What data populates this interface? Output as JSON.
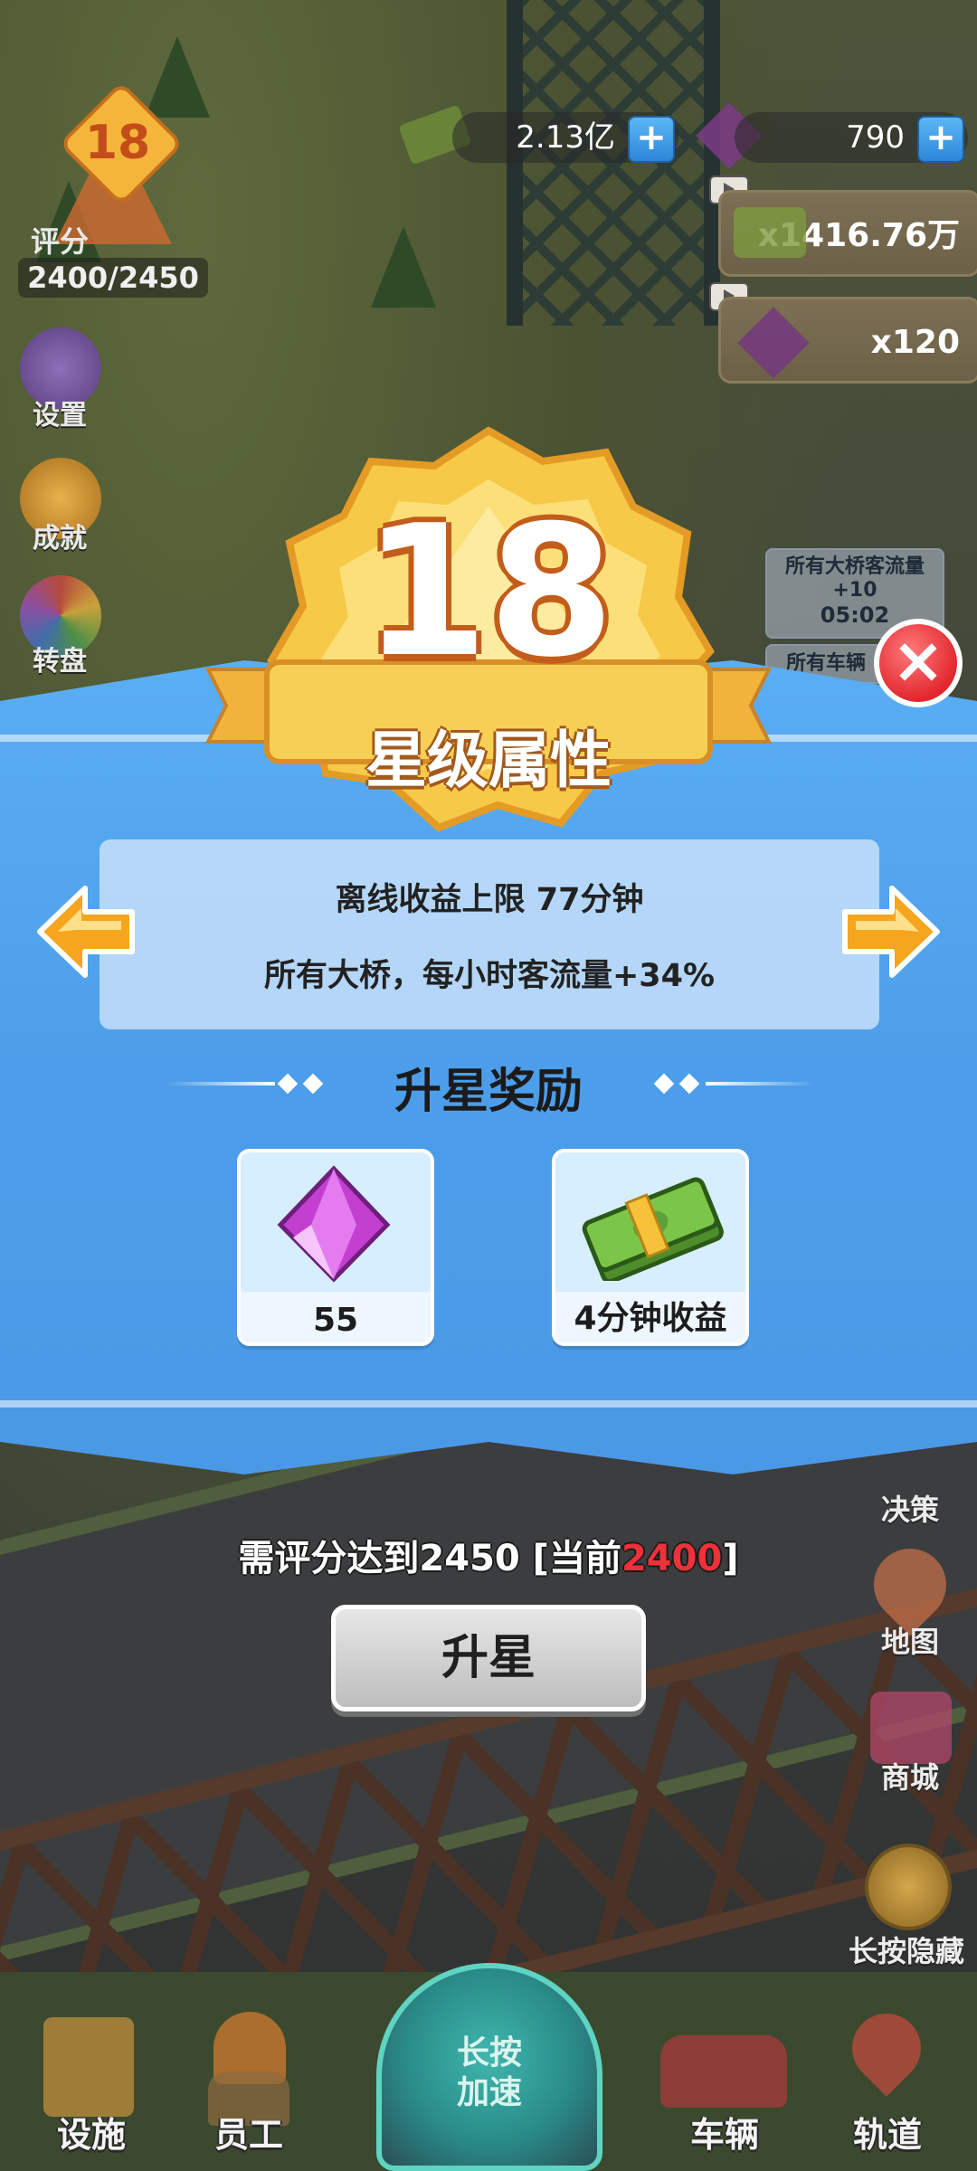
{
  "hud": {
    "rating_level": "18",
    "rating_label": "评分",
    "rating_progress": "2400/2450",
    "cash": "2.13亿",
    "gems": "790",
    "video_cash_reward": "x1416.76万",
    "video_gem_reward": "x120"
  },
  "left_menu": {
    "settings": "设置",
    "achievements": "成就",
    "wheel": "转盘"
  },
  "notices": {
    "bridge_buff_title": "所有大桥客流量+10",
    "bridge_buff_timer": "05:02",
    "vehicle_notice_partial": "所有车辆"
  },
  "dialog": {
    "star_level": "18",
    "title": "星级属性",
    "attributes": [
      "离线收益上限 77分钟",
      "所有大桥，每小时客流量+34%"
    ],
    "reward_title": "升星奖励",
    "rewards": [
      {
        "icon": "purple-gem-icon",
        "label": "55"
      },
      {
        "icon": "cash-bundle-icon",
        "label": "4分钟收益"
      }
    ],
    "requirement_prefix": "需评分达到2450 [当前",
    "requirement_current": "2400",
    "requirement_suffix": "]",
    "upgrade_button": "升星"
  },
  "right_menu": {
    "decision": "决策",
    "map": "地图",
    "shop": "商城",
    "hide": "长按隐藏"
  },
  "bottom_nav": {
    "facilities": "设施",
    "staff": "员工",
    "speed_up": "长按\n加速",
    "vehicles": "车辆",
    "tracks": "轨道"
  },
  "colors": {
    "panel_blue": "#4d9eea",
    "badge_gold": "#f7c948",
    "close_red": "#e2282f",
    "requirement_current": "#f0303a",
    "arrow_orange": "#f6a51e"
  }
}
